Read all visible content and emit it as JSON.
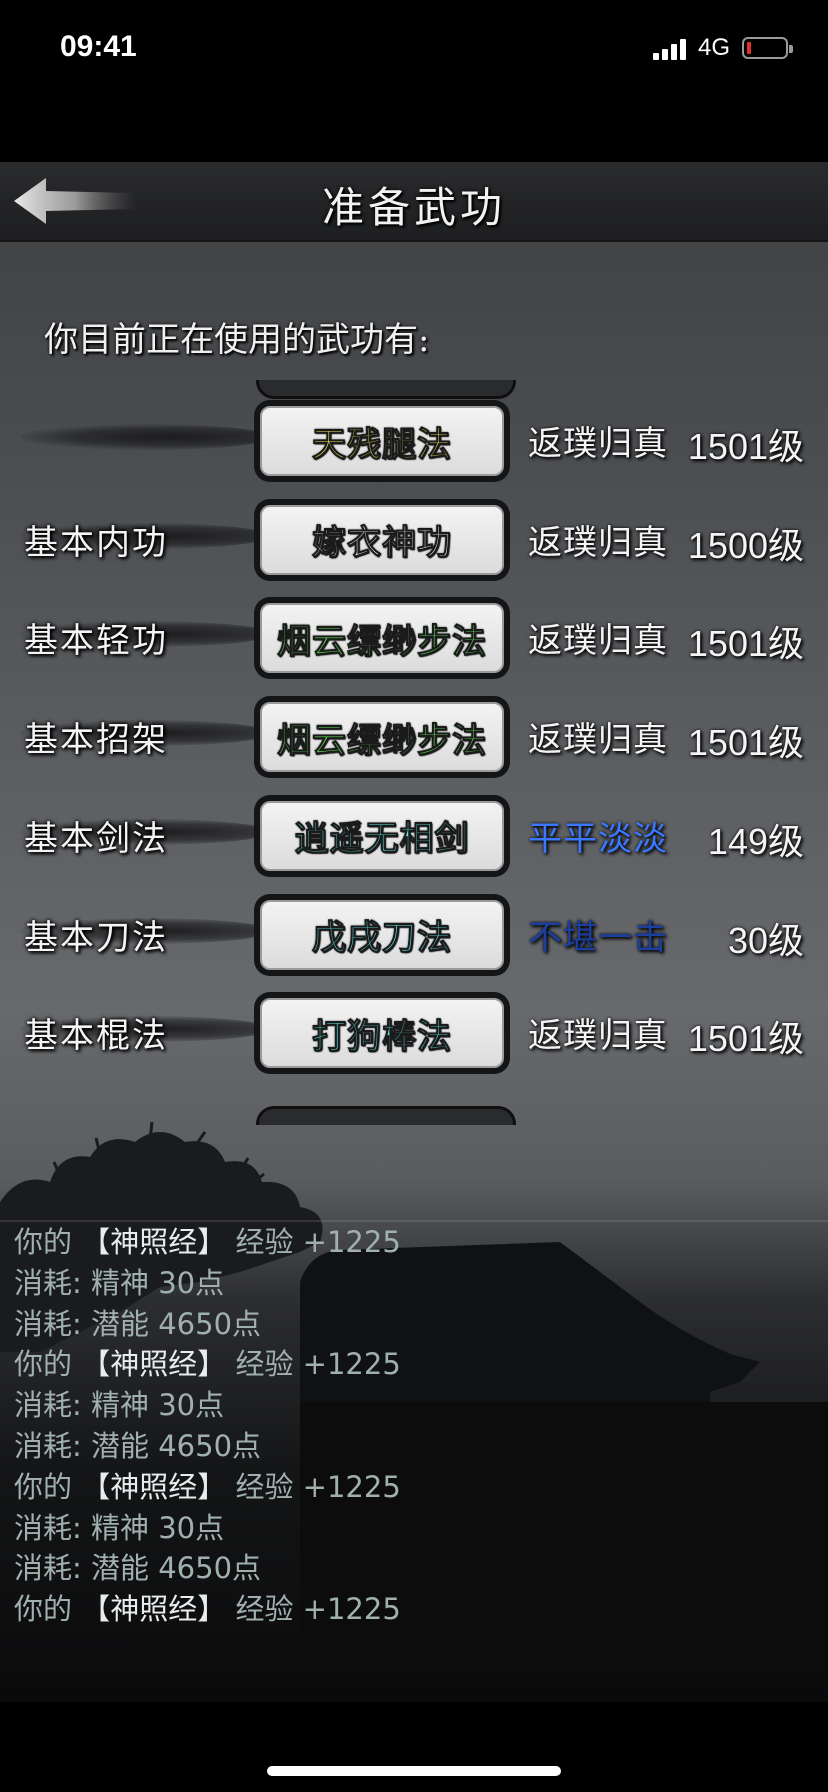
{
  "status_bar": {
    "time": "09:41",
    "network": "4G",
    "battery_color": "#e0302b"
  },
  "header": {
    "title": "准备武功",
    "back_icon": "back-arrow-icon"
  },
  "section_heading": "你目前正在使用的武功有:",
  "skills": [
    {
      "slot": "",
      "name": "天残腿法",
      "name_color": "#f2e85a",
      "level_text": "返璞归真",
      "level_color": "#f4f4f4",
      "level": "1501级"
    },
    {
      "slot": "基本内功",
      "name": "嫁衣神功",
      "name_color": "#f4f4f4",
      "level_text": "返璞归真",
      "level_color": "#f4f4f4",
      "level": "1500级"
    },
    {
      "slot": "基本轻功",
      "name": "烟云缥缈步法",
      "name_color": "#5fe05a",
      "level_text": "返璞归真",
      "level_color": "#f4f4f4",
      "level": "1501级"
    },
    {
      "slot": "基本招架",
      "name": "烟云缥缈步法",
      "name_color": "#5fe05a",
      "level_text": "返璞归真",
      "level_color": "#f4f4f4",
      "level": "1501级"
    },
    {
      "slot": "基本剑法",
      "name": "逍遥无相剑",
      "name_color": "#5ee6e6",
      "level_text": "平平淡淡",
      "level_color": "#3a78ff",
      "level": "149级"
    },
    {
      "slot": "基本刀法",
      "name": "戊戌刀法",
      "name_color": "#5ee6e6",
      "level_text": "不堪一击",
      "level_color": "#1c3e9c",
      "level": "30级"
    },
    {
      "slot": "基本棍法",
      "name": "打狗棒法",
      "name_color": "#5ee6e6",
      "level_text": "返璞归真",
      "level_color": "#f4f4f4",
      "level": "1501级"
    }
  ],
  "log": [
    {
      "a": "你的",
      "b": "【神照经】",
      "c": "经验 +1225"
    },
    {
      "a": "消耗:",
      "b": "精神",
      "c": "30点"
    },
    {
      "a": "消耗:",
      "b": "潜能",
      "c": "4650点"
    },
    {
      "a": "你的",
      "b": "【神照经】",
      "c": "经验 +1225"
    },
    {
      "a": "消耗:",
      "b": "精神",
      "c": "30点"
    },
    {
      "a": "消耗:",
      "b": "潜能",
      "c": "4650点"
    },
    {
      "a": "你的",
      "b": "【神照经】",
      "c": "经验 +1225"
    },
    {
      "a": "消耗:",
      "b": "精神",
      "c": "30点"
    },
    {
      "a": "消耗:",
      "b": "潜能",
      "c": "4650点"
    },
    {
      "a": "你的",
      "b": "【神照经】",
      "c": "经验 +1225"
    }
  ]
}
